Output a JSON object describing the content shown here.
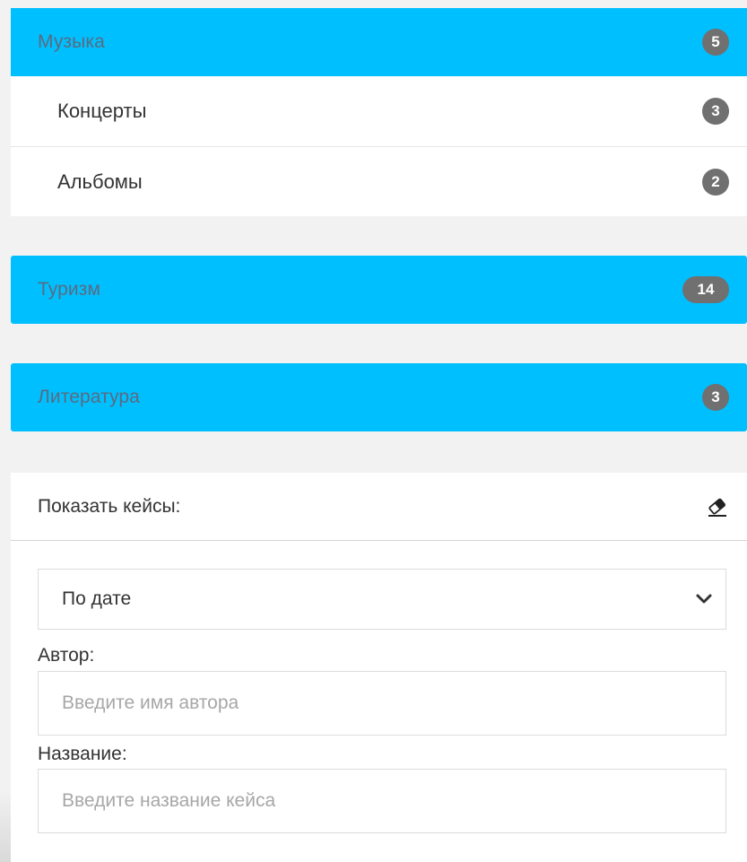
{
  "categories": [
    {
      "title": "Музыка",
      "count": "5",
      "subitems": [
        {
          "label": "Концерты",
          "count": "3"
        },
        {
          "label": "Альбомы",
          "count": "2"
        }
      ]
    },
    {
      "title": "Туризм",
      "count": "14"
    },
    {
      "title": "Литература",
      "count": "3"
    }
  ],
  "filters": {
    "title": "Показать кейсы:",
    "clear_icon": "eraser-icon",
    "sort": {
      "value": "По дате",
      "icon": "chevron-down-icon"
    },
    "author": {
      "label": "Автор:",
      "placeholder": "Введите имя автора"
    },
    "name": {
      "label": "Название:",
      "placeholder": "Введите название кейса"
    }
  },
  "colors": {
    "accent": "#00bfff",
    "badge": "#707070",
    "background": "#f2f2f2"
  }
}
